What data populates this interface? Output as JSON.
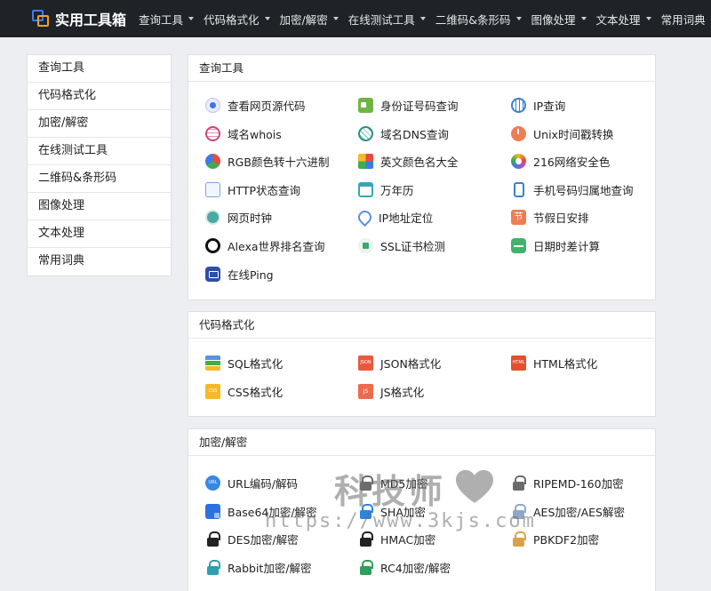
{
  "brand": {
    "title": "实用工具箱"
  },
  "nav": [
    {
      "label": "查询工具"
    },
    {
      "label": "代码格式化"
    },
    {
      "label": "加密/解密"
    },
    {
      "label": "在线测试工具"
    },
    {
      "label": "二维码&条形码"
    },
    {
      "label": "图像处理"
    },
    {
      "label": "文本处理"
    },
    {
      "label": "常用词典"
    }
  ],
  "sidebar": [
    {
      "label": "查询工具"
    },
    {
      "label": "代码格式化"
    },
    {
      "label": "加密/解密"
    },
    {
      "label": "在线测试工具"
    },
    {
      "label": "二维码&条形码"
    },
    {
      "label": "图像处理"
    },
    {
      "label": "文本处理"
    },
    {
      "label": "常用词典"
    }
  ],
  "sections": [
    {
      "title": "查询工具",
      "tools": [
        {
          "label": "查看网页源代码",
          "icon": "webpage-source-icon"
        },
        {
          "label": "身份证号码查询",
          "icon": "id-card-icon"
        },
        {
          "label": "IP查询",
          "icon": "ip-globe-icon"
        },
        {
          "label": "域名whois",
          "icon": "whois-icon"
        },
        {
          "label": "域名DNS查询",
          "icon": "dns-icon"
        },
        {
          "label": "Unix时间戳转换",
          "icon": "unix-clock-icon"
        },
        {
          "label": "RGB颜色转十六进制",
          "icon": "rgb-color-icon"
        },
        {
          "label": "英文颜色名大全",
          "icon": "color-names-icon"
        },
        {
          "label": "216网络安全色",
          "icon": "web-safe-color-icon"
        },
        {
          "label": "HTTP状态查询",
          "icon": "http-status-icon"
        },
        {
          "label": "万年历",
          "icon": "calendar-icon"
        },
        {
          "label": "手机号码归属地查询",
          "icon": "phone-icon"
        },
        {
          "label": "网页时钟",
          "icon": "web-clock-icon"
        },
        {
          "label": "IP地址定位",
          "icon": "location-pin-icon"
        },
        {
          "label": "节假日安排",
          "icon": "holiday-icon",
          "glyph": "节"
        },
        {
          "label": "Alexa世界排名查询",
          "icon": "alexa-icon"
        },
        {
          "label": "SSL证书检测",
          "icon": "ssl-certificate-icon"
        },
        {
          "label": "日期时差计算",
          "icon": "date-diff-icon"
        },
        {
          "label": "在线Ping",
          "icon": "ping-icon"
        }
      ]
    },
    {
      "title": "代码格式化",
      "tools": [
        {
          "label": "SQL格式化",
          "icon": "sql-icon"
        },
        {
          "label": "JSON格式化",
          "icon": "json-icon",
          "glyph": "JSON"
        },
        {
          "label": "HTML格式化",
          "icon": "html-icon",
          "glyph": "HTML"
        },
        {
          "label": "CSS格式化",
          "icon": "css-icon",
          "glyph": "CSS"
        },
        {
          "label": "JS格式化",
          "icon": "js-icon",
          "glyph": "JS"
        }
      ]
    },
    {
      "title": "加密/解密",
      "tools": [
        {
          "label": "URL编码/解码",
          "icon": "url-icon",
          "glyph": "URL"
        },
        {
          "label": "MD5加密",
          "icon": "md5-lock-icon"
        },
        {
          "label": "RIPEMD-160加密",
          "icon": "ripemd-lock-icon"
        },
        {
          "label": "Base64加密/解密",
          "icon": "base64-icon"
        },
        {
          "label": "SHA加密",
          "icon": "sha-lock-icon"
        },
        {
          "label": "AES加密/AES解密",
          "icon": "aes-lock-icon"
        },
        {
          "label": "DES加密/解密",
          "icon": "des-lock-icon"
        },
        {
          "label": "HMAC加密",
          "icon": "hmac-lock-icon"
        },
        {
          "label": "PBKDF2加密",
          "icon": "pbkdf2-lock-icon"
        },
        {
          "label": "Rabbit加密/解密",
          "icon": "rabbit-lock-icon"
        },
        {
          "label": "RC4加密/解密",
          "icon": "rc4-lock-icon"
        }
      ]
    }
  ],
  "watermark": {
    "line1": "科技师",
    "line2": "https://www.3kjs.com"
  },
  "colors": {
    "navbar": "#1f2328",
    "background": "#eceef1",
    "panel": "#ffffff",
    "border": "#dde0e4"
  }
}
